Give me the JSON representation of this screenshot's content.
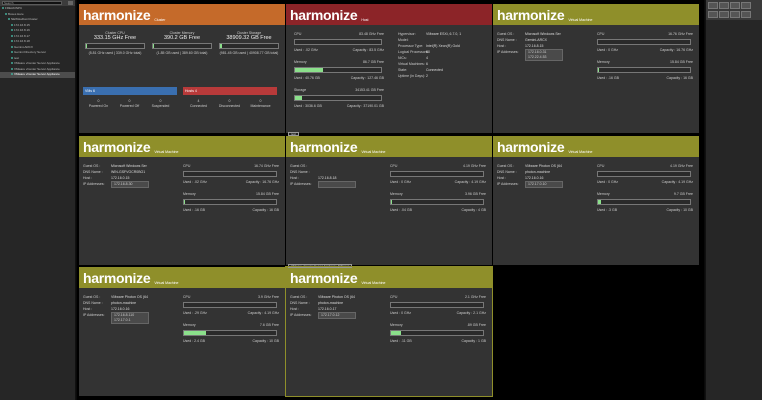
{
  "search": {
    "placeholder": "Search"
  },
  "tree": [
    {
      "label": "FREAKINPC",
      "sel": false,
      "indent": 0
    },
    {
      "label": "Boxes Here",
      "sel": false,
      "indent": 1
    },
    {
      "label": "NEWHaDomCluster",
      "sel": false,
      "indent": 2
    },
    {
      "label": "172.16.8.15",
      "sel": false,
      "indent": 3
    },
    {
      "label": "172.16.8.16",
      "sel": false,
      "indent": 3
    },
    {
      "label": "172.16.8.17",
      "sel": false,
      "indent": 3
    },
    {
      "label": "172.16.8.18",
      "sel": false,
      "indent": 3
    },
    {
      "label": "Gemini-ARCX",
      "sel": false,
      "indent": 3
    },
    {
      "label": "Gemini Directory Server",
      "sel": false,
      "indent": 3
    },
    {
      "label": "test",
      "sel": false,
      "indent": 3
    },
    {
      "label": "VMware vCenter Server Appliance",
      "sel": false,
      "indent": 3
    },
    {
      "label": "VMware vCenter Server Appliance",
      "sel": false,
      "indent": 3
    },
    {
      "label": "VMware vCenter Server Appliance",
      "sel": true,
      "indent": 3
    }
  ],
  "tiles": {
    "cluster": {
      "logo": "harmonize",
      "sub": "Cluster",
      "cpu_label": "Cluster CPU",
      "cpu_free": "333.15 GHz Free",
      "cpu_detail": "(5.81 GHz used | 339.0 GHz total)",
      "mem_label": "Cluster Memory",
      "mem_free": "390.2 GB Free",
      "mem_detail": "(1.85 GB used | 389.60 GB total)",
      "sto_label": "Cluster Storage",
      "sto_free": "38909.32 GB Free",
      "sto_detail": "(981.45 GB used | 40908.77 GB total)",
      "vms_label": "VMs",
      "vms_count": "6",
      "hosts_label": "Hosts",
      "hosts_count": "4",
      "vm_states": [
        [
          "0",
          "Powered On"
        ],
        [
          "0",
          "Powered Off"
        ],
        [
          "0",
          "Suspended"
        ]
      ],
      "host_states": [
        [
          "4",
          "Connected"
        ],
        [
          "0",
          "Disconnected"
        ],
        [
          "0",
          "Maintenance"
        ]
      ]
    },
    "host": {
      "logo": "harmonize",
      "sub": "Host",
      "cpu_label": "CPU",
      "cpu_free": "83.48 GHz",
      "cpu_free_unit": "Free",
      "cpu_used": "Used : .02 GHz",
      "cpu_cap": "Capacity : 83.5 GHz",
      "mem_label": "Memory",
      "mem_free": "86.7 GB",
      "mem_free_unit": "Free",
      "mem_used": "Used : 40.76 GB",
      "mem_cap": "Capacity : 127.46 GB",
      "sto_label": "Storage",
      "sto_free": "34153.41 GB",
      "sto_free_unit": "Free",
      "sto_used": "Used : 3036.6 GB",
      "sto_cap": "Capacity : 37190.01 GB",
      "info": [
        [
          "Hypervisor:",
          "VMware ESXi, 6.7.0, 1"
        ],
        [
          "Model:",
          ""
        ],
        [
          "Processor Type:",
          "Intel(R) Xeon(R) Gold"
        ],
        [
          "Logical Processors:",
          "80"
        ],
        [
          "NICs:",
          "4"
        ],
        [
          "Virtual Machines:",
          "6"
        ],
        [
          "State:",
          "Connected"
        ],
        [
          "Uptime (in Days):",
          "2"
        ]
      ],
      "tabmark": "test"
    },
    "vms": [
      {
        "sub": "Virtual Machine",
        "os": "Microsoft Windows Ser",
        "dns": "Gemini-ARCX",
        "host": "172.16.8.15",
        "ips": [
          "172.16.0.31",
          "172.22.4.53"
        ],
        "cpu_free": "16.76 GHz",
        "cpu_used": "Used : 0 GHz",
        "cpu_cap": "Capacity : 16.76 GHz",
        "mem_free": "15.84 GB",
        "mem_used": "Used : .16 GB",
        "mem_cap": "Capacity : 16 GB",
        "mem_pct": 1
      },
      {
        "sub": "Virtual Machine",
        "os": "Microsoft Windows Ser",
        "dns": "WIN-GSFVOCR0BO1",
        "host": "172.16.0.15",
        "ips": [
          "172.16.8.30"
        ],
        "cpu_free": "16.74 GHz",
        "cpu_used": "Used : .02 GHz",
        "cpu_cap": "Capacity : 16.76 GHz",
        "mem_free": "15.84 GB",
        "mem_used": "Used : .16 GB",
        "mem_cap": "Capacity : 16 GB",
        "mem_pct": 1
      },
      {
        "sub": "Virtual Machine",
        "os": "",
        "dns": "",
        "host": "172.16.8.18",
        "ips": [
          ""
        ],
        "cpu_free": "4.19 GHz",
        "cpu_used": "Used : 0 GHz",
        "cpu_cap": "Capacity : 4.19 GHz",
        "mem_free": "3.96 GB",
        "mem_used": "Used : .04 GB",
        "mem_cap": "Capacity : 4 GB",
        "mem_pct": 1
      },
      {
        "sub": "Virtual Machine",
        "os": "VMware Photon OS (64",
        "dns": "photon-machine",
        "host": "172.16.0.16",
        "ips": [
          "172.17.0.10"
        ],
        "cpu_free": "4.19 GHz",
        "cpu_used": "Used : 0 GHz",
        "cpu_cap": "Capacity : 4.19 GHz",
        "mem_free": "9.7 GB",
        "mem_used": "Used : .3 GB",
        "mem_cap": "Capacity : 10 GB",
        "mem_pct": 3
      },
      {
        "sub": "Virtual Machine",
        "os": "VMware Photon OS (64",
        "dns": "photon-machine",
        "host": "172.16.0.16",
        "ips": [
          "172.16.8.110",
          "172.17.0.1"
        ],
        "cpu_free": "3.9 GHz",
        "cpu_used": "Used : .29 GHz",
        "cpu_cap": "Capacity : 4.19 GHz",
        "mem_free": "7.6 GB",
        "mem_used": "Used : 2.4 GB",
        "mem_cap": "Capacity : 10 GB",
        "mem_pct": 24
      },
      {
        "sub": "Virtual Machine",
        "os": "VMware Photon OS (64",
        "dns": "photon-machine",
        "host": "172.16.0.17",
        "ips": [
          "172.17.0.12"
        ],
        "cpu_free": "2.1 GHz",
        "cpu_used": "Used : 0 GHz",
        "cpu_cap": "Capacity : 2.1 GHz",
        "mem_free": ".89 GB",
        "mem_used": "Used : .11 GB",
        "mem_cap": "Capacity : 1 GB",
        "mem_pct": 11
      }
    ],
    "vm_labels": {
      "logo": "harmonize",
      "os": "Guest OS :",
      "dns": "DNS Name :",
      "host": "Host :",
      "ip": "IP Addresses:",
      "cpu": "CPU",
      "mem": "Memory",
      "free": "Free"
    },
    "sel_tabmark": "VMware vCenter Server Appliance (Witness"
  }
}
